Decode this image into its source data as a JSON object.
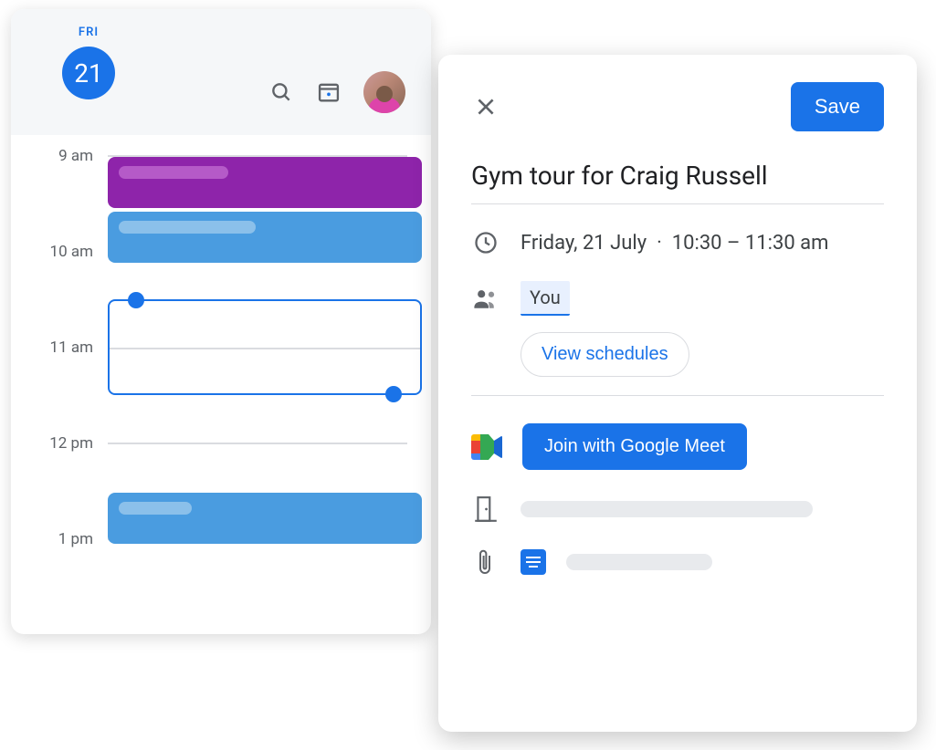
{
  "calendar": {
    "dow": "FRI",
    "day": "21",
    "hours": [
      "9 am",
      "10 am",
      "11 am",
      "12 pm",
      "1 pm"
    ]
  },
  "event": {
    "save_label": "Save",
    "title": "Gym tour for Craig Russell",
    "date_text": "Friday, 21 July",
    "time_text": "10:30 – 11:30 am",
    "guest_self": "You",
    "view_schedules": "View schedules",
    "meet_label": "Join with Google Meet"
  }
}
